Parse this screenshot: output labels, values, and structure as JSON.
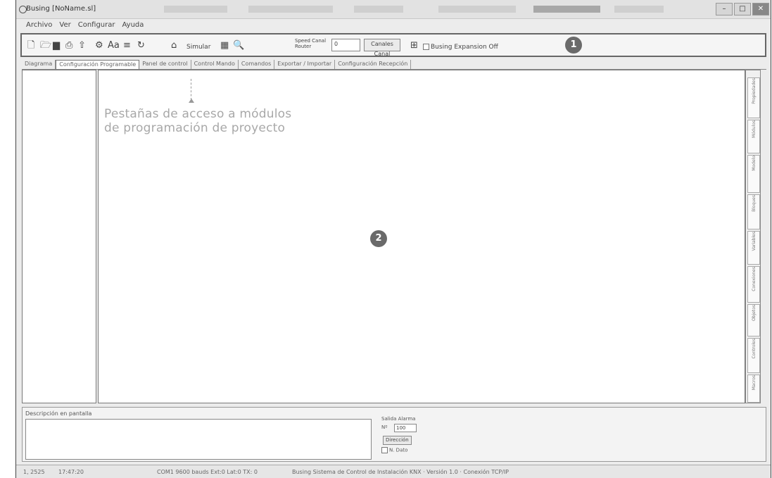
{
  "window": {
    "title": "Busing [NoName.sl]",
    "controls": {
      "minimize": "–",
      "maximize": "□",
      "close": "✕"
    }
  },
  "menu": {
    "items": [
      "Archivo",
      "Ver",
      "Configurar",
      "Ayuda"
    ]
  },
  "toolbar": {
    "simulate_label": "Simular",
    "speed_label": "Speed Canal Router",
    "speed_value": "0",
    "clear_label": "Canales Canal",
    "show_expansion_label": "Busing Expansion Off",
    "badge": "1"
  },
  "tabs": [
    "Diagrama",
    "Configuración Programable",
    "Panel de control",
    "Control Mando",
    "Comandos",
    "Exportar / Importar",
    "Configuración Recepción"
  ],
  "annotation": {
    "line1": "Pestañas de acceso a módulos",
    "line2": "de programación de proyecto",
    "badge": "2"
  },
  "side_tabs": [
    "Propiedades",
    "Módulos",
    "Modelo",
    "Bloques",
    "Variables",
    "Conexiones",
    "Objetos",
    "Controles",
    "Macros"
  ],
  "bottom": {
    "label": "Descripción en pantalla",
    "panel_title": "Salida Alarma",
    "field_label": "Nº",
    "field_value": "100",
    "button_label": "Dirección",
    "checkbox_label": "N. Dato"
  },
  "status": {
    "position": "1, 2525",
    "time": "17:47:20",
    "port": "COM1 9600 bauds  Ext:0  Lat:0  TX: 0",
    "message": "Busing Sistema de Control de Instalación KNX · Versión 1.0 · Conexión TCP/IP"
  },
  "colors": {
    "badge": "#6a6a6a",
    "annotation_text": "#a8a8a8",
    "background": "#ececec"
  }
}
